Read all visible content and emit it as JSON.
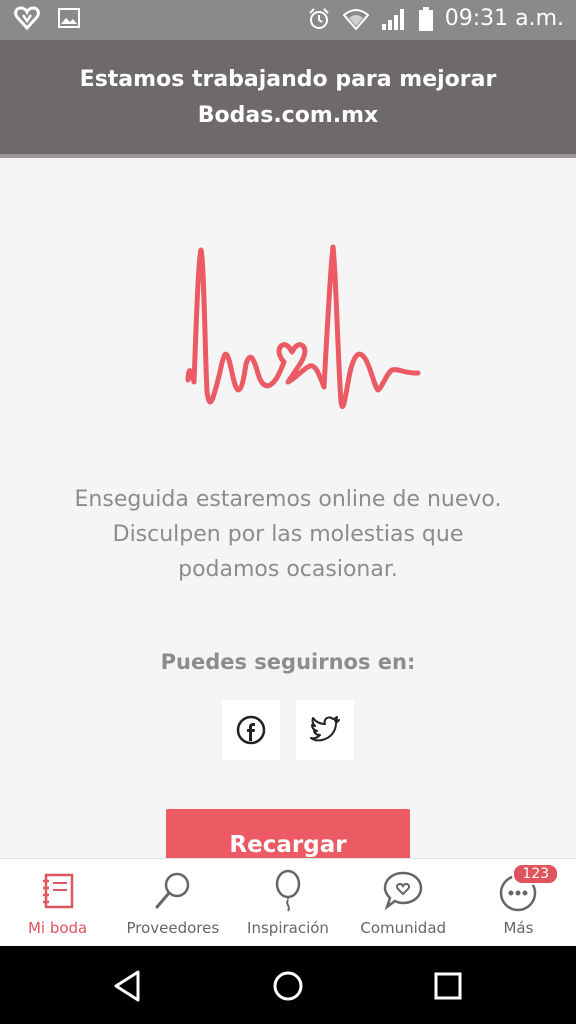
{
  "status_bar": {
    "time": "09:31 a.m.",
    "left_icons": [
      "app-heart-icon",
      "image-icon"
    ],
    "right_icons": [
      "alarm-icon",
      "wifi-icon",
      "signal-icon",
      "battery-icon"
    ]
  },
  "banner": {
    "line1": "Estamos trabajando para mejorar",
    "line2": "Bodas.com.mx"
  },
  "main": {
    "message_line1": "Enseguida estaremos online de nuevo.",
    "message_line2": "Disculpen por las molestias que podamos ocasionar.",
    "follow_label": "Puedes seguirnos en:",
    "social": [
      "facebook-icon",
      "twitter-icon"
    ],
    "reload_label": "Recargar"
  },
  "bottom_nav": {
    "items": [
      {
        "label": "Mi boda",
        "icon": "notebook-icon",
        "active": true
      },
      {
        "label": "Proveedores",
        "icon": "magnifier-icon"
      },
      {
        "label": "Inspiración",
        "icon": "balloon-icon"
      },
      {
        "label": "Comunidad",
        "icon": "chat-heart-icon"
      },
      {
        "label": "Más",
        "icon": "more-dots-icon",
        "badge": "123"
      }
    ]
  },
  "colors": {
    "accent": "#ec5a63",
    "banner": "#6e6a6b",
    "text_muted": "#8c8c8c"
  }
}
